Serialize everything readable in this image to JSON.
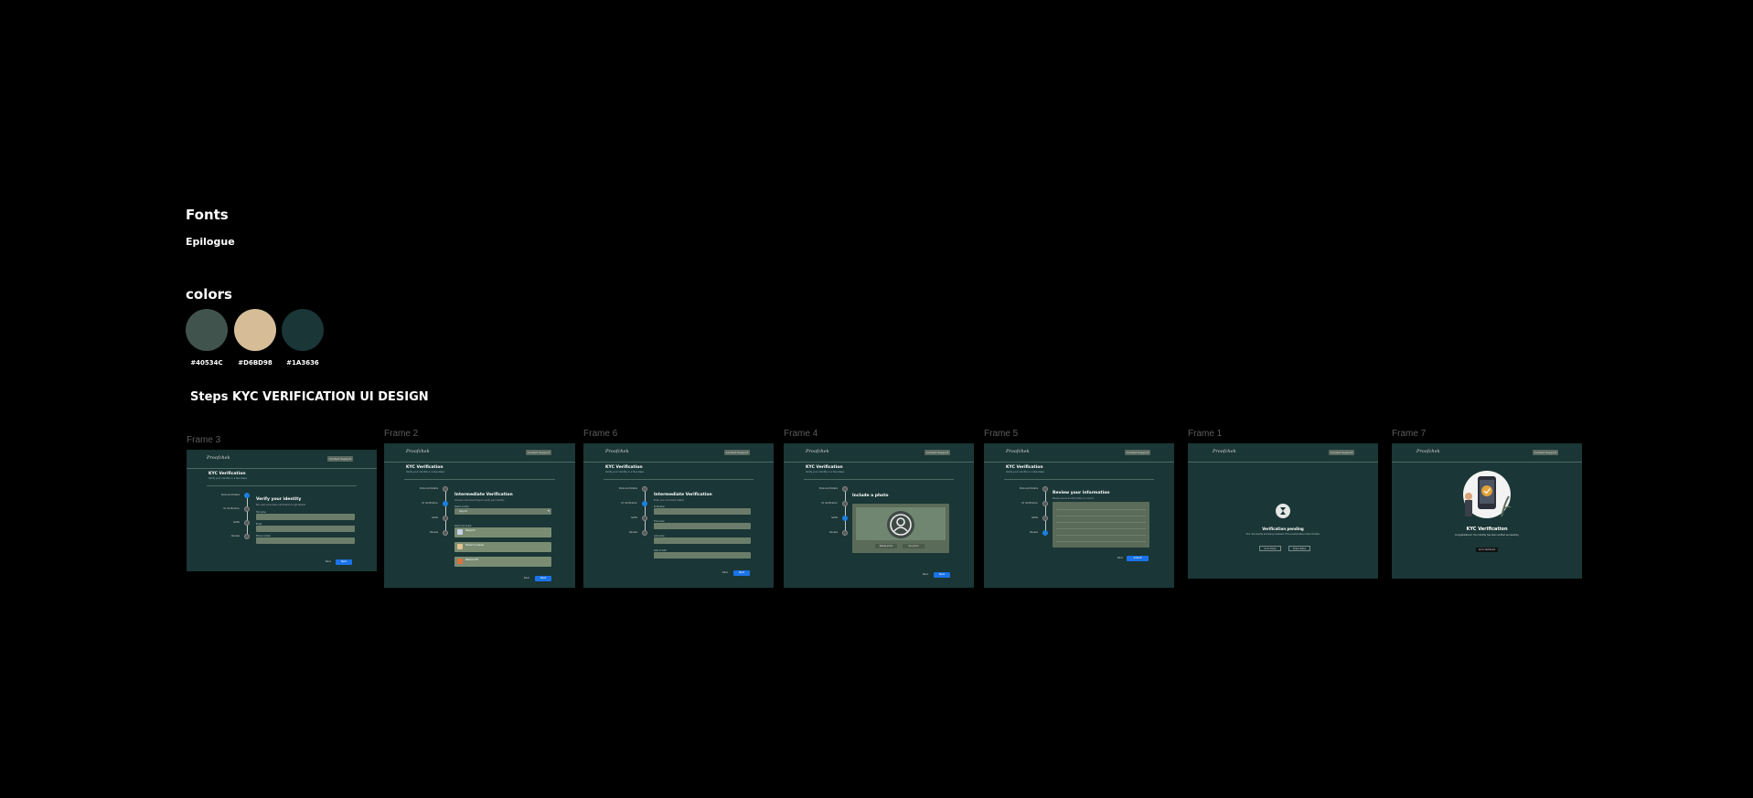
{
  "fonts": {
    "heading": "Fonts",
    "font_name": "Epilogue"
  },
  "colors": {
    "heading": "colors",
    "swatches": [
      {
        "label": "#40534C",
        "hex": "#40534C"
      },
      {
        "label": "#D6BD98",
        "hex": "#D6BD98"
      },
      {
        "label": "#1A3636",
        "hex": "#1A3636"
      }
    ]
  },
  "steps_heading": "Steps KYC VERIFICATION UI DESIGN",
  "frames": [
    {
      "label": "Frame 3"
    },
    {
      "label": "Frame 2"
    },
    {
      "label": "Frame 6"
    },
    {
      "label": "Frame 4"
    },
    {
      "label": "Frame 5"
    },
    {
      "label": "Frame 1"
    },
    {
      "label": "Frame 7"
    }
  ],
  "mockup": {
    "logo": "Proofchek",
    "top_button": "Contact Support",
    "kyc_title": "KYC Verification",
    "kyc_sub": "Verify your identity in a few steps",
    "steps": [
      "Personal Details",
      "ID Verification",
      "Selfie",
      "Review"
    ],
    "step_subs": [
      "Basic information",
      "Upload document",
      "Take a photo",
      "Confirm details"
    ],
    "back": "Back",
    "next": "Next",
    "frame3": {
      "title": "Verify your identity",
      "sub": "We need some basic information to get started",
      "fields": [
        "Full name",
        "Email",
        "Phone number"
      ]
    },
    "frame2": {
      "title": "Intermediate Verification",
      "sub": "Choose a document type to verify your identity",
      "select_label": "Select country",
      "select_value": "Nigeria",
      "docs_label": "Select document",
      "docs": [
        "Passport",
        "Driver's License",
        "National ID"
      ]
    },
    "frame6": {
      "title": "Intermediate Verification",
      "sub": "Enter your document details",
      "fields": [
        "ID Number",
        "First name",
        "Last name",
        "Date of birth"
      ]
    },
    "frame4": {
      "title": "Include a photo",
      "retake": "Retake photo",
      "use": "Use photo"
    },
    "frame5": {
      "title": "Review your information",
      "sub": "Please ensure all information is correct",
      "submit": "Submit"
    },
    "frame1": {
      "title": "Verification pending",
      "sub": "Your documents are being reviewed. This usually takes a few minutes.",
      "btn1": "Go to Home",
      "btn2": "Check status"
    },
    "frame7": {
      "title": "KYC Verification",
      "sub": "Congratulations! Your identity has been verified successfully.",
      "btn": "Go to dashboard"
    }
  }
}
